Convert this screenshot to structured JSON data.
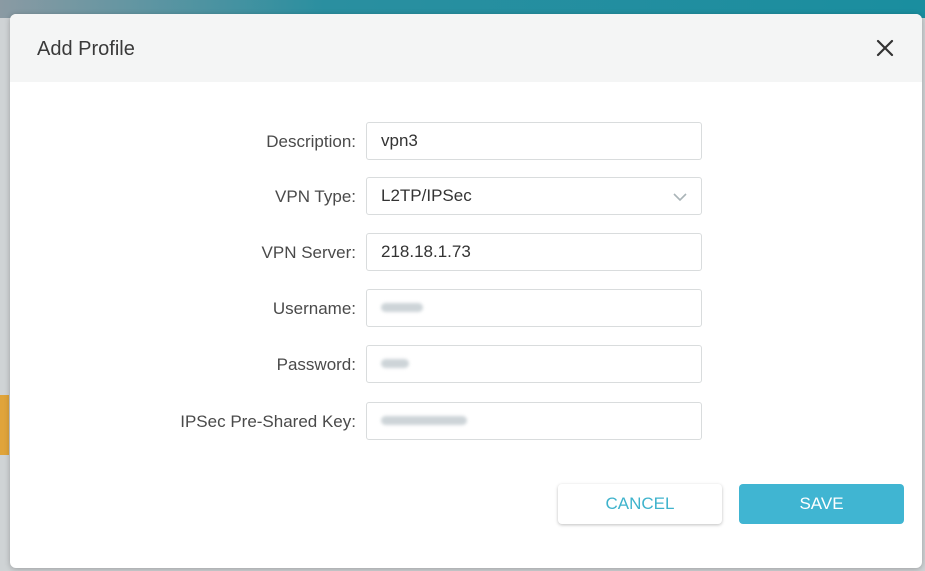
{
  "dialog": {
    "title": "Add Profile",
    "close_icon": "close-icon"
  },
  "form": {
    "description": {
      "label": "Description:",
      "value": "vpn3"
    },
    "vpn_type": {
      "label": "VPN Type:",
      "value": "L2TP/IPSec",
      "icon": "chevron-down-icon"
    },
    "vpn_server": {
      "label": "VPN Server:",
      "value": "218.18.1.73"
    },
    "username": {
      "label": "Username:",
      "value_state": "redacted"
    },
    "password": {
      "label": "Password:",
      "value_state": "redacted"
    },
    "psk": {
      "label": "IPSec Pre-Shared Key:",
      "value_state": "redacted"
    }
  },
  "buttons": {
    "cancel": "CANCEL",
    "save": "SAVE"
  },
  "colors": {
    "accent": "#40b5d2",
    "cancel_text": "#3fb3cc",
    "header_bg": "#f4f5f5"
  }
}
